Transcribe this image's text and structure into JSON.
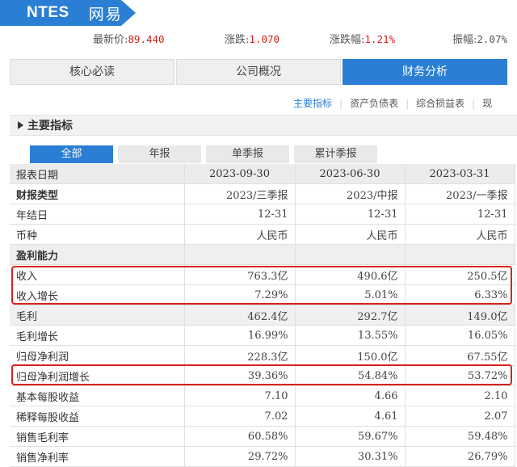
{
  "stock": {
    "code": "NTES",
    "name": "网易"
  },
  "quote": [
    {
      "label": "最新价:",
      "value": "89.440"
    },
    {
      "label": "涨跌:",
      "value": "1.070"
    },
    {
      "label": "涨跌幅:",
      "value": "1.21%"
    },
    {
      "label": "振幅:",
      "value": "2.07%"
    }
  ],
  "main_tabs": [
    {
      "label": "核心必读",
      "active": false
    },
    {
      "label": "公司概况",
      "active": false
    },
    {
      "label": "财务分析",
      "active": true
    }
  ],
  "sub_links": [
    {
      "label": "主要指标",
      "active": true
    },
    {
      "label": "资产负债表",
      "active": false
    },
    {
      "label": "综合损益表",
      "active": false
    },
    {
      "label": "现",
      "active": false
    }
  ],
  "section_title": "主要指标",
  "period_tabs": [
    {
      "label": "全部",
      "active": true
    },
    {
      "label": "年报",
      "active": false
    },
    {
      "label": "单季报",
      "active": false
    },
    {
      "label": "累计季报",
      "active": false
    }
  ],
  "table": {
    "header": [
      "报表日期",
      "2023-09-30",
      "2023-06-30",
      "2023-03-31"
    ],
    "rows": [
      {
        "label": "财报类型",
        "values": [
          "2023/三季报",
          "2023/中报",
          "2023/一季报"
        ],
        "style": "bold"
      },
      {
        "label": "年结日",
        "values": [
          "12-31",
          "12-31",
          "12-31"
        ],
        "style": ""
      },
      {
        "label": "币种",
        "values": [
          "人民币",
          "人民币",
          "人民币"
        ],
        "style": ""
      },
      {
        "label": "盈利能力",
        "values": [
          "",
          "",
          ""
        ],
        "style": "sect"
      },
      {
        "label": "收入",
        "values": [
          "763.3亿",
          "490.6亿",
          "250.5亿"
        ],
        "style": ""
      },
      {
        "label": "收入增长",
        "values": [
          "7.29%",
          "5.01%",
          "6.33%"
        ],
        "style": ""
      },
      {
        "label": "毛利",
        "values": [
          "462.4亿",
          "292.7亿",
          "149.0亿"
        ],
        "style": "gray"
      },
      {
        "label": "毛利增长",
        "values": [
          "16.99%",
          "13.55%",
          "16.05%"
        ],
        "style": ""
      },
      {
        "label": "归母净利润",
        "values": [
          "228.3亿",
          "150.0亿",
          "67.55亿"
        ],
        "style": ""
      },
      {
        "label": "归母净利润增长",
        "values": [
          "39.36%",
          "54.84%",
          "53.72%"
        ],
        "style": ""
      },
      {
        "label": "基本每股收益",
        "values": [
          "7.10",
          "4.66",
          "2.10"
        ],
        "style": ""
      },
      {
        "label": "稀释每股收益",
        "values": [
          "7.02",
          "4.61",
          "2.07"
        ],
        "style": ""
      },
      {
        "label": "销售毛利率",
        "values": [
          "60.58%",
          "59.67%",
          "59.48%"
        ],
        "style": ""
      },
      {
        "label": "销售净利率",
        "values": [
          "29.72%",
          "30.31%",
          "26.79%"
        ],
        "style": ""
      }
    ]
  },
  "colors": {
    "accent": "#2a7ed3",
    "up": "#d4211c",
    "highlight": "#d6231d"
  }
}
